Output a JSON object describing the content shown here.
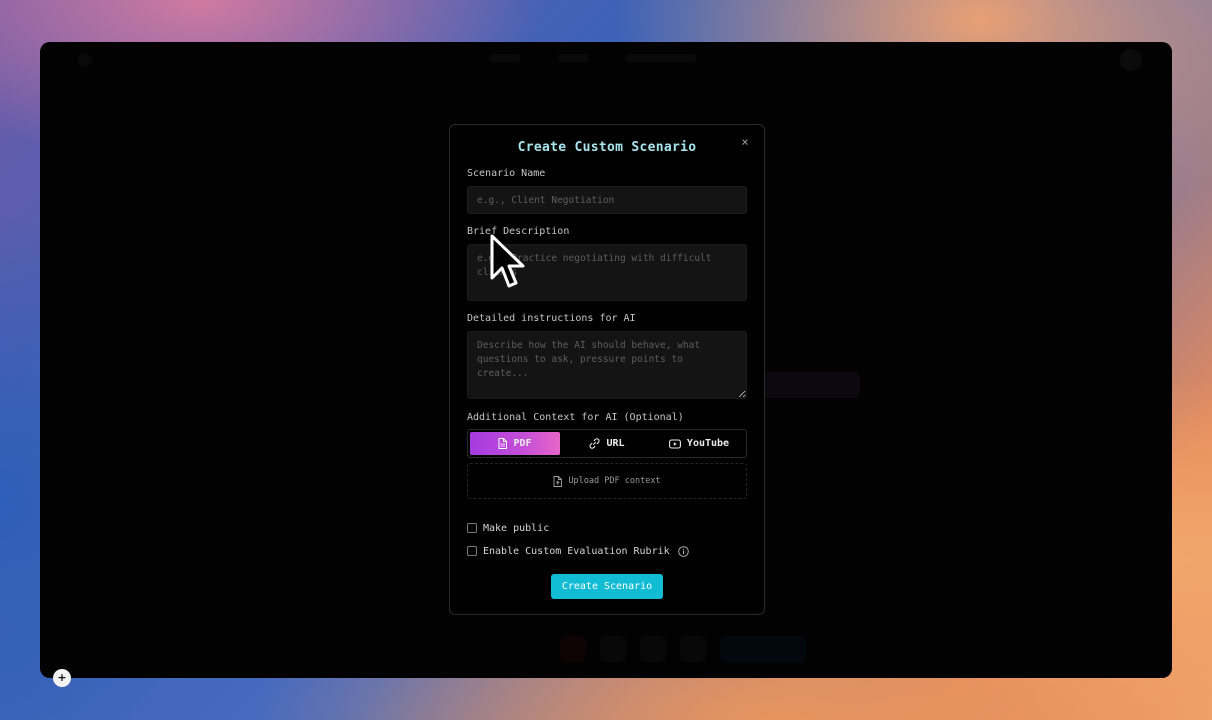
{
  "modal": {
    "title": "Create Custom Scenario",
    "close_label": "×",
    "scenario_name": {
      "label": "Scenario Name",
      "value": "",
      "placeholder": "e.g., Client Negotiation"
    },
    "brief_description": {
      "label": "Brief Description",
      "value": "",
      "placeholder": "e.g., Practice negotiating with difficult clients"
    },
    "instructions": {
      "label": "Detailed instructions for AI",
      "value": "",
      "placeholder": "Describe how the AI should behave, what questions to ask, pressure points to create..."
    },
    "context": {
      "label": "Additional Context for AI (Optional)",
      "tabs": [
        {
          "label": "PDF",
          "icon": "file-icon",
          "active": true
        },
        {
          "label": "URL",
          "icon": "link-icon",
          "active": false
        },
        {
          "label": "YouTube",
          "icon": "youtube-icon",
          "active": false
        }
      ],
      "upload_label": "Upload PDF context",
      "upload_icon": "file-upload-icon"
    },
    "make_public": {
      "label": "Make public",
      "checked": false
    },
    "custom_rubrik": {
      "label": "Enable Custom Evaluation Rubrik",
      "checked": false,
      "icon": "info-icon"
    },
    "submit_label": "Create Scenario"
  },
  "colors": {
    "title": "#a6e6ee",
    "tab_active_start": "#a53be0",
    "tab_active_end": "#e667c9",
    "submit": "#12bcd4",
    "modal_bg": "#000000",
    "field_bg": "#141414"
  },
  "badge": {
    "label": "+",
    "icon": "plus-icon"
  }
}
